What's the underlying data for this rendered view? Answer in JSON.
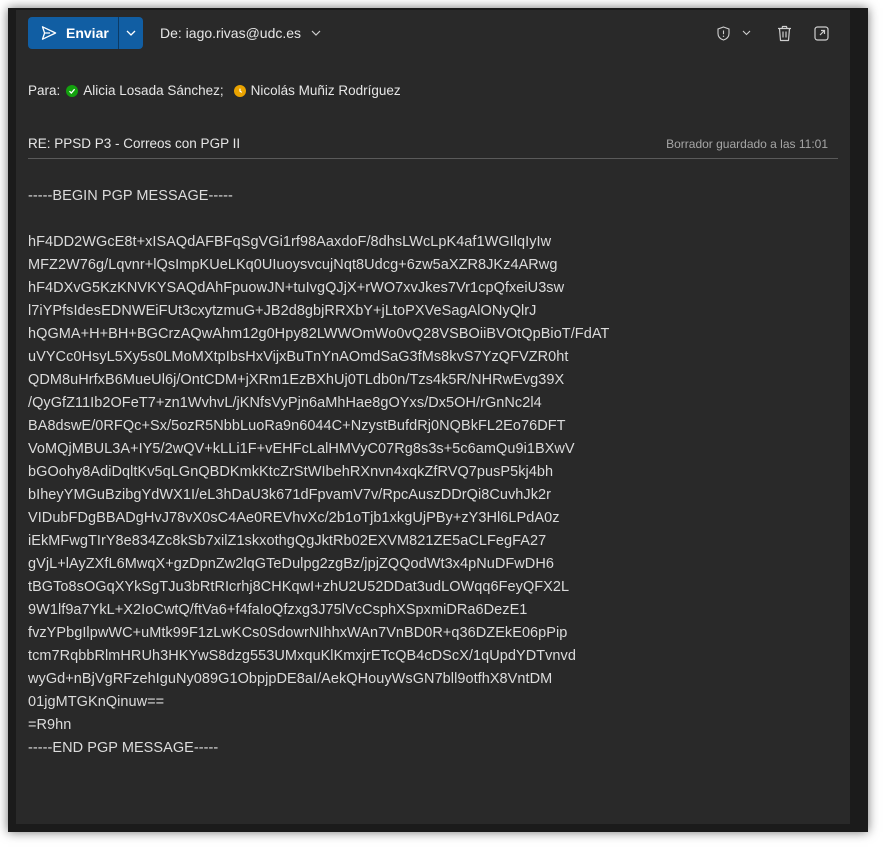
{
  "toolbar": {
    "send_label": "Enviar",
    "from_label": "De: iago.rivas@udc.es"
  },
  "recipients": {
    "to_label": "Para:",
    "items": [
      {
        "name": "Alicia Losada Sánchez;",
        "status": "available",
        "status_color": "#13a10e"
      },
      {
        "name": "Nicolás Muñiz Rodríguez",
        "status": "away",
        "status_color": "#eaa300"
      }
    ]
  },
  "subject": "RE: PPSD P3 - Correos con PGP II",
  "draft_status": "Borrador guardado a las 11:01",
  "body": {
    "begin": "-----BEGIN PGP MESSAGE-----",
    "lines": [
      "hF4DD2WGcE8t+xISAQdAFBFqSgVGi1rf98AaxdoF/8dhsLWcLpK4af1WGIlqIyIw",
      "MFZ2W76g/Lqvnr+lQsImpKUeLKq0UIuoysvcujNqt8Udcg+6zw5aXZR8JKz4ARwg",
      "hF4DXvG5KzKNVKYSAQdAhFpuowJN+tuIvgQJjX+rWO7xvJkes7Vr1cpQfxeiU3sw",
      "l7iYPfsIdesEDNWEiFUt3cxytzmuG+JB2d8gbjRRXbY+jLtoPXVeSagAlONyQlrJ",
      "hQGMA+H+BH+BGCrzAQwAhm12g0Hpy82LWWOmWo0vQ28VSBOiiBVOtQpBioT/FdAT",
      "uVYCc0HsyL5Xy5s0LMoMXtpIbsHxVijxBuTnYnAOmdSaG3fMs8kvS7YzQFVZR0ht",
      "QDM8uHrfxB6MueUl6j/OntCDM+jXRm1EzBXhUj0TLdb0n/Tzs4k5R/NHRwEvg39X",
      "/QyGfZ11Ib2OFeT7+zn1WvhvL/jKNfsVyPjn6aMhHae8gOYxs/Dx5OH/rGnNc2l4",
      "BA8dswE/0RFQc+Sx/5ozR5NbbLuoRa9n6044C+NzystBufdRj0NQBkFL2Eo76DFT",
      "VoMQjMBUL3A+IY5/2wQV+kLLi1F+vEHFcLalHMVyC07Rg8s3s+5c6amQu9i1BXwV",
      "bGOohy8AdiDqltKv5qLGnQBDKmkKtcZrStWIbehRXnvn4xqkZfRVQ7pusP5kj4bh",
      "bIheyYMGuBzibgYdWX1I/eL3hDaU3k671dFpvamV7v/RpcAuszDDrQi8CuvhJk2r",
      "VIDubFDgBBADgHvJ78vX0sC4Ae0REVhvXc/2b1oTjb1xkgUjPBy+zY3Hl6LPdA0z",
      "iEkMFwgTIrY8e834Zc8kSb7xilZ1skxothgQgJktRb02EXVM821ZE5aCLFegFA27",
      "gVjL+lAyZXfL6MwqX+gzDpnZw2lqGTeDulpg2zgBz/jpjZQQodWt3x4pNuDFwDH6",
      "tBGTo8sOGqXYkSgTJu3bRtRIcrhj8CHKqwI+zhU2U52DDat3udLOWqq6FeyQFX2L",
      "9W1lf9a7YkL+X2IoCwtQ/ftVa6+f4faIoQfzxg3J75lVcCsphXSpxmiDRa6DezE1",
      "fvzYPbgIlpwWC+uMtk99F1zLwKCs0SdowrNIhhxWAn7VnBD0R+q36DZEkE06pPip",
      "tcm7RqbbRlmHRUh3HKYwS8dzg553UMxquKlKmxjrETcQB4cDScX/1qUpdYDTvnvd",
      "wyGd+nBjVgRFzehIguNy089G1ObpjpDE8aI/AekQHouyWsGN7bll9otfhX8VntDM",
      "01jgMTGKnQinuw==",
      "=R9hn"
    ],
    "end": "-----END PGP MESSAGE-----"
  },
  "colors": {
    "window_bg": "#292929",
    "accent": "#115ea3",
    "text": "#e6e6e6",
    "muted": "#a6a6a6"
  }
}
